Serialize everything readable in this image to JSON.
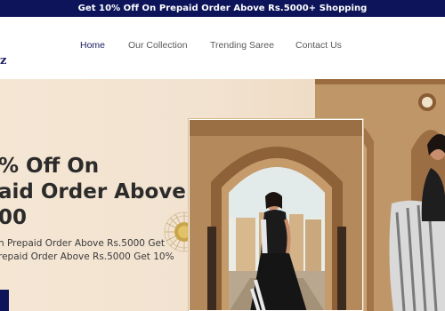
{
  "announcement": {
    "text": "Get 10% Off On Prepaid Order Above Rs.5000+ Shopping"
  },
  "header": {
    "logo_fragment": "z",
    "nav": [
      {
        "label": "Home",
        "active": true
      },
      {
        "label": "Our Collection",
        "active": false
      },
      {
        "label": "Trending Saree",
        "active": false
      },
      {
        "label": "Contact Us",
        "active": false
      }
    ]
  },
  "hero": {
    "headline_lines": [
      "% Off On",
      "aid Order Above",
      "00"
    ],
    "subtext_lines": [
      "n Prepaid Order Above Rs.5000 Get",
      "repaid Order Above Rs.5000 Get 10%"
    ]
  },
  "colors": {
    "brand_navy": "#0d1459",
    "nav_active": "#1b2060",
    "hero_bg": "#f2e3d1",
    "sandstone": "#b78c5c"
  },
  "icons": [
    "sun-medallion-icon"
  ]
}
